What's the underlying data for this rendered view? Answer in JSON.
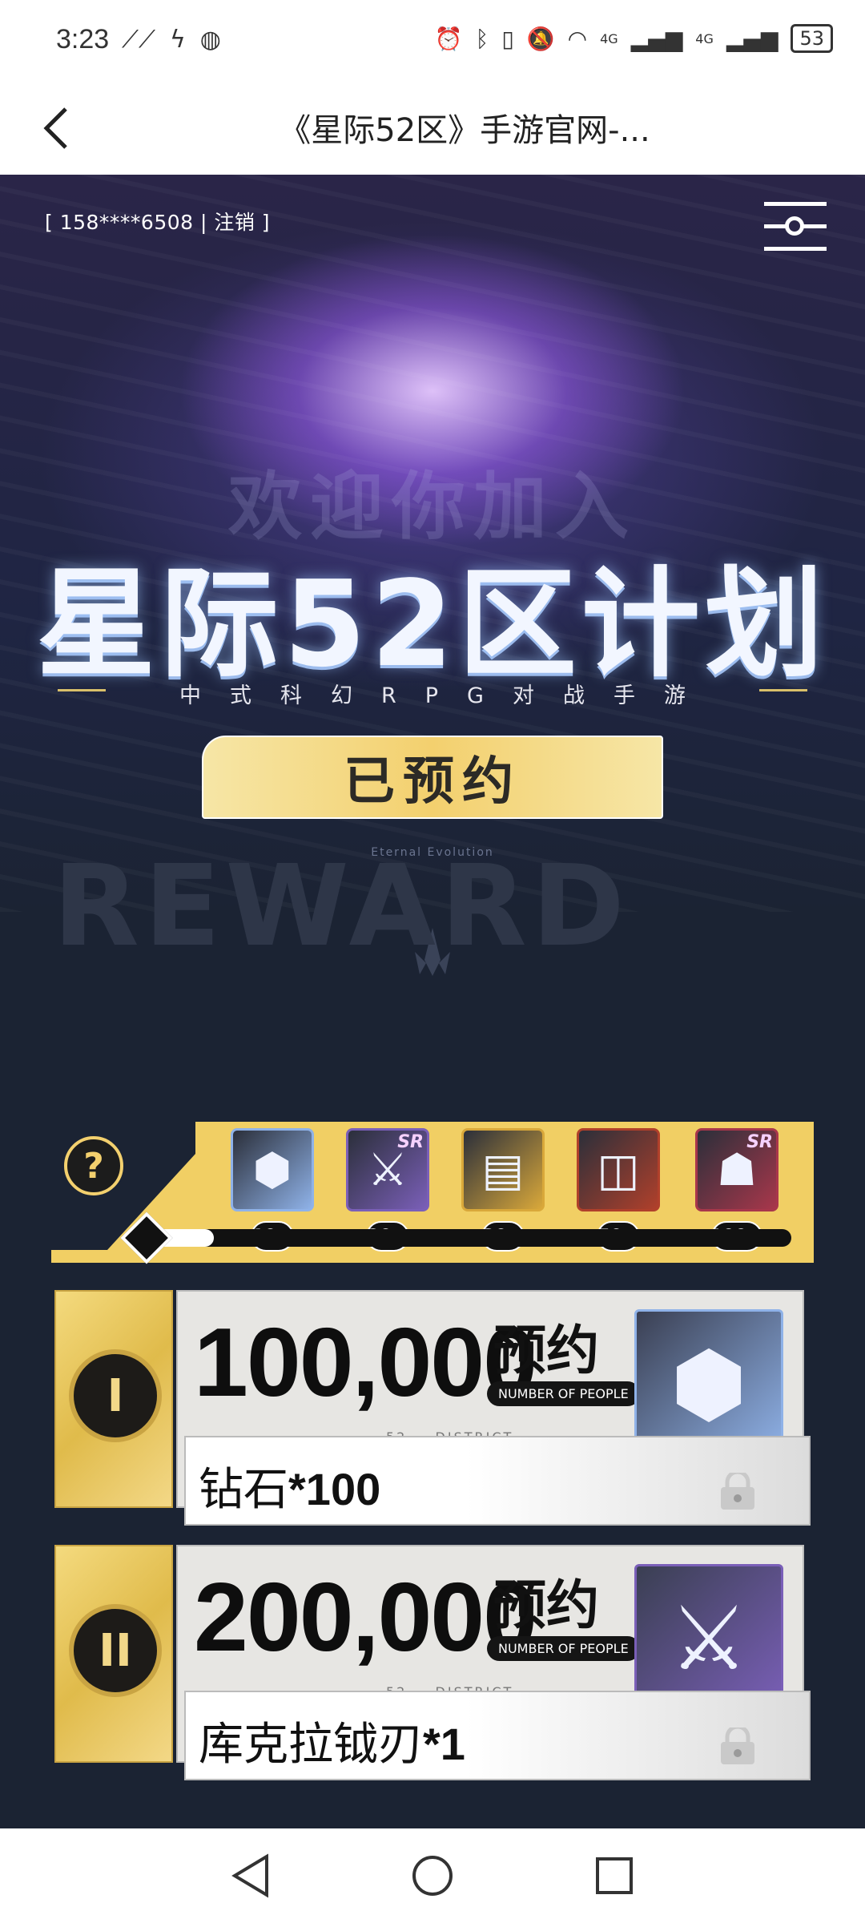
{
  "status_bar": {
    "time": "3:23",
    "battery": "53",
    "network_1": "4G",
    "network_2": "4G"
  },
  "header": {
    "title": "《星际52区》手游官网-..."
  },
  "hero": {
    "account_text": "[ 158****6508 | 注销 ]",
    "welcome_text": "欢迎你加入",
    "game_title": "星际52区计划",
    "subtitle": "中式科幻RPG对战手游",
    "reserve_button": "已预约",
    "tagline": "Eternal Evolution"
  },
  "reward": {
    "heading": "REWARD",
    "help_label": "?",
    "progress_fraction": 0.06,
    "milestones": [
      {
        "label": "10w",
        "icon": "diamond-icon",
        "color": "#8fb2e8",
        "sr": ""
      },
      {
        "label": "20w",
        "icon": "scythe-icon",
        "color": "#7a5fb8",
        "sr": "SR"
      },
      {
        "label": "30w",
        "icon": "card-icon",
        "color": "#d9a83a",
        "sr": ""
      },
      {
        "label": "50w",
        "icon": "frame-icon",
        "color": "#b0402b",
        "sr": ""
      },
      {
        "label": "100w",
        "icon": "character-icon",
        "color": "#a8374b",
        "sr": "SR"
      }
    ],
    "cards": [
      {
        "tier": "I",
        "count": "100,000",
        "reserve": "预约",
        "nop": "NUMBER OF PEOPLE",
        "district": "52 — DISTRICT",
        "reward_name": "钻石",
        "reward_qty": "*100"
      },
      {
        "tier": "II",
        "count": "200,000",
        "reserve": "预约",
        "nop": "NUMBER OF PEOPLE",
        "district": "52 — DISTRICT",
        "reward_name": "库克拉钺刃",
        "reward_qty": "*1"
      }
    ]
  }
}
